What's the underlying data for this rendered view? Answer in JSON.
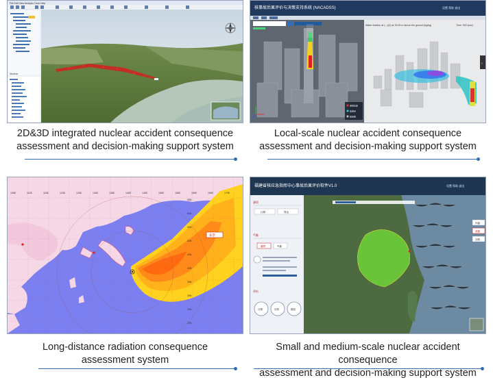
{
  "panels": [
    {
      "caption_line1": "2D&3D integrated nuclear accident consequence",
      "caption_line2": "assessment and decision-making support system",
      "app": {
        "tree_root": "Nuclear",
        "toolbar": "File  Edit  View  Analysis  Tools  Help"
      }
    },
    {
      "caption_line1": "Local-scale nuclear accident consequence",
      "caption_line2": "assessment and decision-making support system",
      "app": {
        "window_title": "核事故后果评价与决策支持系统 (NACADSS)",
        "header_links": "设置  帮助  退出",
        "legend": [
          "源项位置",
          "监测点",
          "建筑物"
        ],
        "water_note": "Water fraction at (...)(X) at 15.00 m above the ground (kg/kg)",
        "time_label": "Time: 900 (sec)"
      }
    },
    {
      "caption_line1": "Long-distance radiation consequence",
      "caption_line2": "assessment system",
      "app": {
        "lon_ticks": [
          "105E",
          "110E",
          "115E",
          "120E",
          "125E",
          "130E",
          "135E",
          "140E",
          "145E",
          "150E",
          "155E",
          "160E",
          "165E",
          "170E"
        ],
        "lat_ticks": [
          "65N",
          "60N",
          "55N",
          "50N",
          "45N",
          "40N",
          "35N",
          "30N",
          "25N",
          "20N"
        ],
        "place_label": "东京"
      }
    },
    {
      "caption_line1": "Small and medium-scale nuclear accident consequence",
      "caption_line2": "assessment and decision-making support system",
      "app": {
        "window_title": "福建省核应急指挥中心事故后果评价软件V1.0",
        "header_links": "设置  帮助  退出",
        "side_sections": [
          "源项",
          "气象",
          "评价"
        ],
        "buttons": [
          "计算",
          "导出",
          "源项",
          "气象"
        ],
        "round_buttons": [
          "计算",
          "分析",
          "报告"
        ],
        "right_tabs": [
          "剂量",
          "浓度",
          "沉积"
        ]
      }
    }
  ],
  "colors": {
    "accent_rule": "#2f6fb8",
    "frame_border": "#9aa6b8",
    "caption_text": "#222222"
  }
}
